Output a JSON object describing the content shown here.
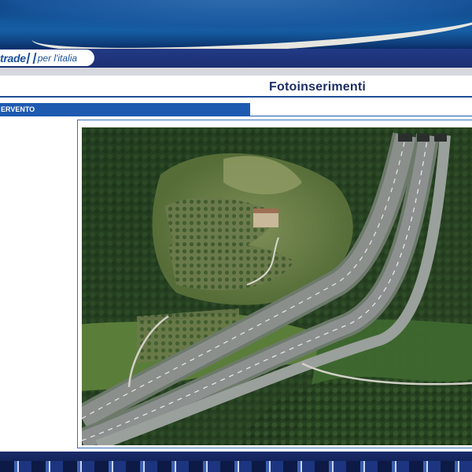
{
  "brand": {
    "name_fragment": "trade",
    "tagline": "per l'italia"
  },
  "page": {
    "title": "Fotoinserimenti",
    "section_label": "ERVENTO"
  },
  "photo": {
    "description_icon": "aerial-highway-photo-icon"
  },
  "colors": {
    "brand_blue": "#1a4f99",
    "bar_blue": "#1e5ab0",
    "title_navy": "#1c2e64"
  }
}
